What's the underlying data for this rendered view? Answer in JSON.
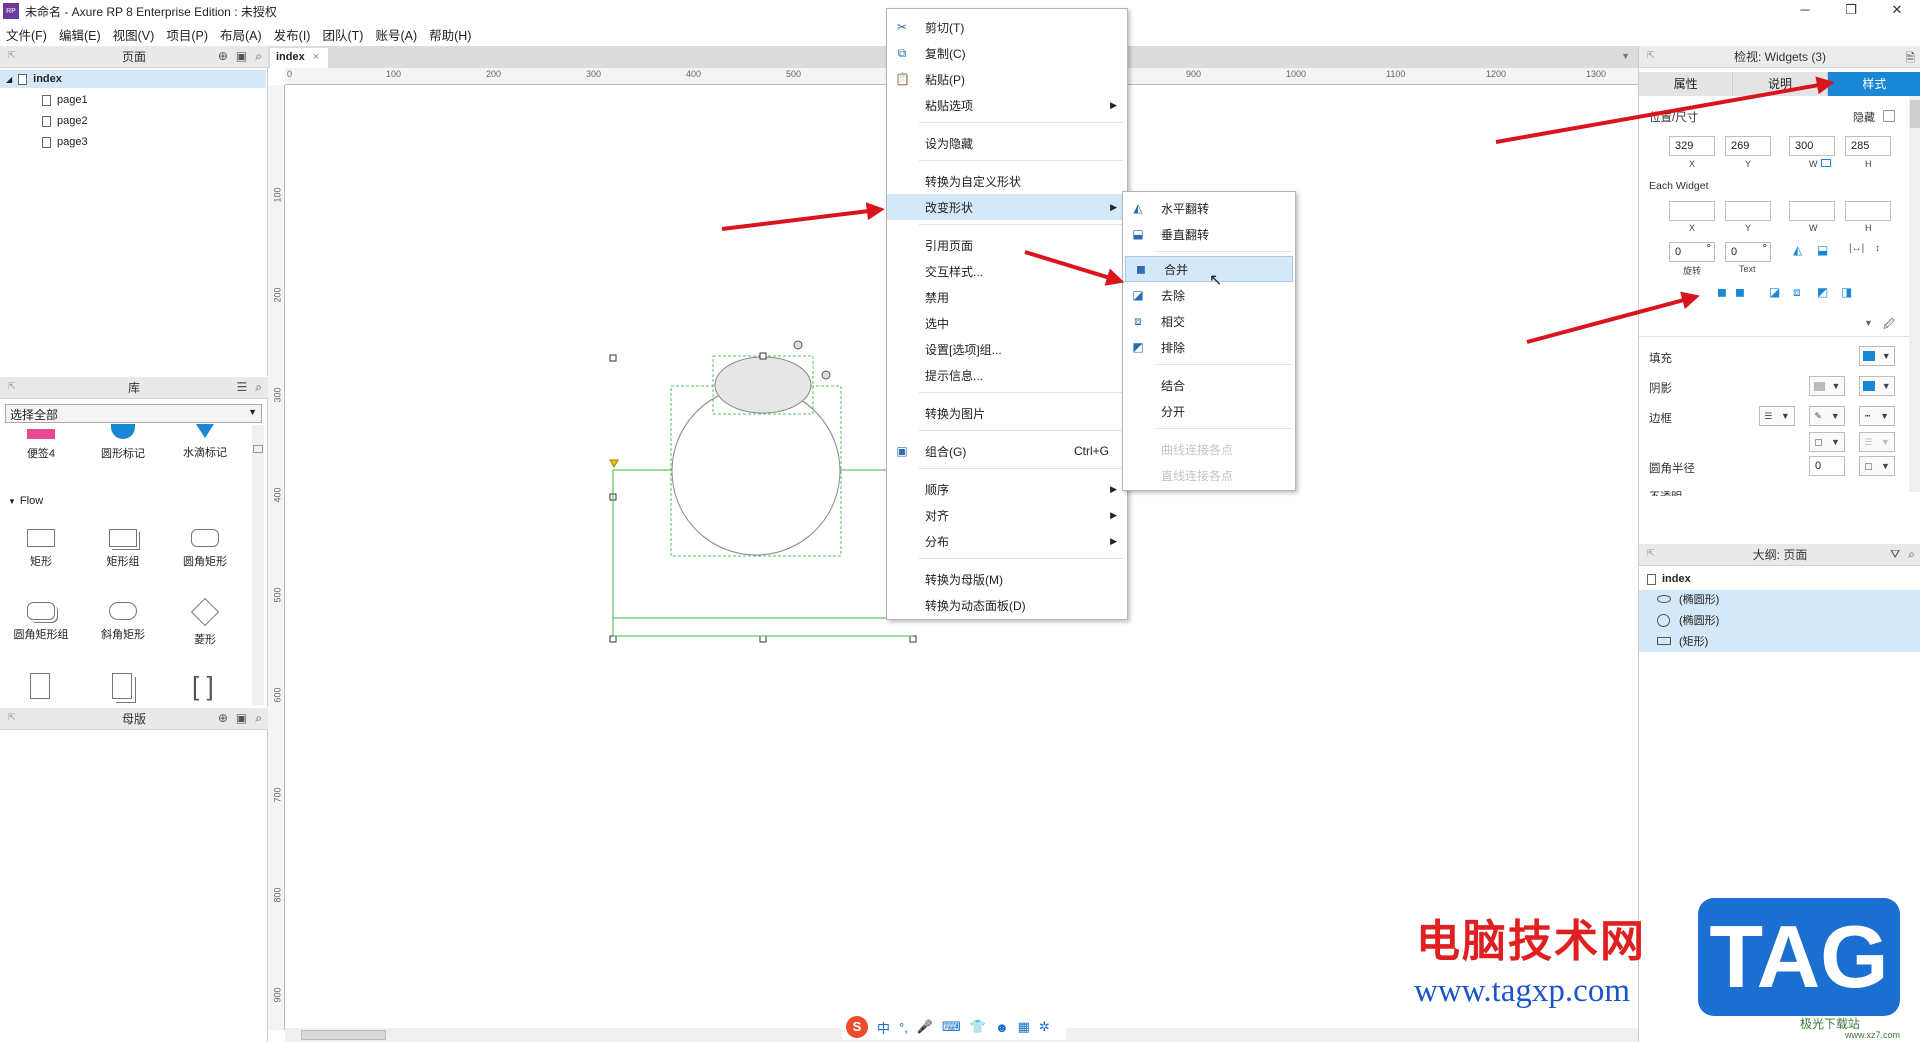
{
  "app": {
    "title": "未命名 - Axure RP 8 Enterprise Edition : 未授权",
    "logo": "RP"
  },
  "window_buttons": [
    "─",
    "❐",
    "✕"
  ],
  "menubar": [
    "文件(F)",
    "编辑(E)",
    "视图(V)",
    "项目(P)",
    "布局(A)",
    "发布(I)",
    "团队(T)",
    "账号(A)",
    "帮助(H)"
  ],
  "pages_panel": {
    "title": "页面",
    "root": "index",
    "children": [
      "page1",
      "page2",
      "page3"
    ]
  },
  "library_panel": {
    "title": "库",
    "select_value": "选择全部",
    "top_items": [
      "便签4",
      "圆形标记",
      "水滴标记"
    ],
    "section": "Flow",
    "items": [
      "矩形",
      "矩形组",
      "圆角矩形",
      "圆角矩形组",
      "斜角矩形",
      "菱形"
    ],
    "bracket": "[ ]"
  },
  "masters_panel": {
    "title": "母版"
  },
  "canvas_tab": {
    "label": "index",
    "close": "×"
  },
  "ruler_h": [
    "0",
    "100",
    "200",
    "300",
    "400",
    "500",
    "900",
    "1000",
    "1100",
    "1200",
    "1300"
  ],
  "ruler_v": [
    "100",
    "200",
    "300",
    "400",
    "500",
    "600",
    "700",
    "800",
    "900"
  ],
  "context_menu": {
    "items": [
      {
        "label": "剪切(T)",
        "icon": "scissors-icon"
      },
      {
        "label": "复制(C)",
        "icon": "copy-icon"
      },
      {
        "label": "粘贴(P)",
        "icon": "paste-icon"
      },
      {
        "label": "粘贴选项",
        "submenu": true
      },
      {
        "label": "设为隐藏"
      },
      {
        "label": "转换为自定义形状"
      },
      {
        "label": "改变形状",
        "submenu": true,
        "highlight": true
      },
      {
        "label": "引用页面"
      },
      {
        "label": "交互样式..."
      },
      {
        "label": "禁用"
      },
      {
        "label": "选中"
      },
      {
        "label": "设置[选项]组..."
      },
      {
        "label": "提示信息..."
      },
      {
        "label": "转换为图片"
      },
      {
        "label": "组合(G)",
        "shortcut": "Ctrl+G",
        "icon": "group-icon"
      },
      {
        "label": "顺序",
        "submenu": true
      },
      {
        "label": "对齐",
        "submenu": true
      },
      {
        "label": "分布",
        "submenu": true
      },
      {
        "label": "转换为母版(M)"
      },
      {
        "label": "转换为动态面板(D)"
      }
    ]
  },
  "submenu": {
    "items": [
      {
        "label": "水平翻转"
      },
      {
        "label": "垂直翻转"
      },
      {
        "label": "合并",
        "highlight": true
      },
      {
        "label": "去除"
      },
      {
        "label": "相交"
      },
      {
        "label": "排除"
      },
      {
        "label": "结合"
      },
      {
        "label": "分开"
      },
      {
        "label": "曲线连接各点",
        "disabled": true
      },
      {
        "label": "直线连接各点",
        "disabled": true
      }
    ]
  },
  "inspector": {
    "title": "检视: Widgets (3)",
    "tabs": [
      "属性",
      "说明",
      "样式"
    ],
    "active_tab": "样式",
    "position_label": "位置/尺寸",
    "hidden_label": "隐藏",
    "x": "329",
    "y": "269",
    "w": "300",
    "h": "285",
    "labels": {
      "x": "X",
      "y": "Y",
      "w": "W",
      "h": "H"
    },
    "each_widget": "Each Widget",
    "rotate": "0",
    "rotate_label": "旋转",
    "text_rot": "0",
    "text_label": "Text",
    "deg": "°",
    "fill": "填充",
    "shadow": "阴影",
    "border": "边框",
    "radius": "圆角半径",
    "radius_value": "0",
    "more": "不透明"
  },
  "outline": {
    "title": "大纲: 页面",
    "root": "index",
    "items": [
      "(椭圆形)",
      "(椭圆形)",
      "(矩形)"
    ]
  },
  "watermark": {
    "cn": "电脑技术网",
    "url": "www.tagxp.com",
    "tag": "TAG",
    "sub": "极光下载站",
    "sub_url": "www.xz7.com"
  },
  "colors": {
    "arrow": "#d9141c",
    "highlight": "#d4e8f8",
    "accent": "#1a87d4"
  }
}
